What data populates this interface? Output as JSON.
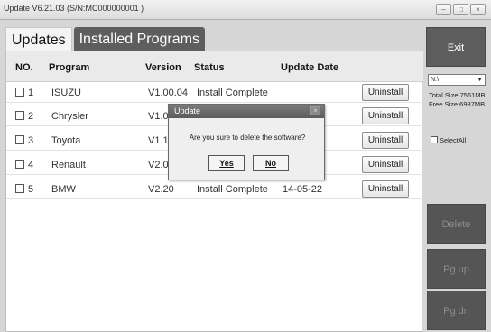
{
  "window": {
    "title": "Update V6.21.03 (S/N:MC000000001 )",
    "controls": [
      "minimize-icon",
      "maximize-icon",
      "close-icon"
    ]
  },
  "tabs": [
    {
      "label": "Updates",
      "active": false
    },
    {
      "label": "Installed Programs",
      "active": true
    }
  ],
  "table": {
    "headers": [
      "NO.",
      "Program",
      "Version",
      "Status",
      "Update Date"
    ],
    "rows": [
      {
        "no": "1",
        "program": "ISUZU",
        "version": "V1.00.04",
        "status": "Install Complete",
        "date": "",
        "action": "Uninstall"
      },
      {
        "no": "2",
        "program": "Chrysler",
        "version": "V1.0(",
        "status": "",
        "date": "",
        "action": "Uninstall"
      },
      {
        "no": "3",
        "program": "Toyota",
        "version": "V1.1(",
        "status": "",
        "date": "",
        "action": "Uninstall"
      },
      {
        "no": "4",
        "program": "Renault",
        "version": "V2.0(",
        "status": "",
        "date": "",
        "action": "Uninstall"
      },
      {
        "no": "5",
        "program": "BMW",
        "version": "V2.20",
        "status": "Install Complete",
        "date": "14-05-22",
        "action": "Uninstall"
      }
    ]
  },
  "sidebar": {
    "exit_label": "Exit",
    "drive_value": "N:\\",
    "total_size": "Total Size:7561MB",
    "free_size": "Free Size:6937MB",
    "select_all_label": "SelectAll",
    "delete_label": "Delete",
    "pgup_label": "Pg up",
    "pgdn_label": "Pg dn"
  },
  "dialog": {
    "title": "Update",
    "message": "Are you sure to delete the software?",
    "yes_label": "Yes",
    "no_label": "No"
  },
  "colors": {
    "active_tab": "#5e5e5e",
    "side_button": "#555555",
    "dialog_title": "#6a6a6a"
  }
}
